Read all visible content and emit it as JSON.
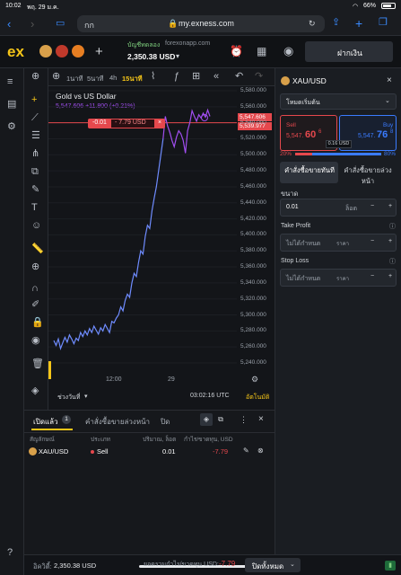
{
  "status_bar": {
    "time": "10:02",
    "date": "พฤ. 29 ม.ค.",
    "battery": "66%"
  },
  "browser": {
    "url_left": "กก",
    "url": "my.exness.com"
  },
  "app": {
    "logo": "ex",
    "account_type": "บัญชีทดลอง",
    "server": "forexonapp.com",
    "balance": "2,350.38 USD",
    "deposit_label": "ฝากเงิน"
  },
  "chart_toolbar": {
    "timeframes": [
      "1นาที",
      "5นาที",
      "4h",
      "15นาที"
    ],
    "active_timeframe": "15นาที"
  },
  "chart": {
    "title": "Gold vs US Dollar",
    "quote": "5,547.606 +11.800 (+0.21%)",
    "position_tag": {
      "pnl": "-0.01",
      "value": "- 7.79 USD",
      "close": "×"
    },
    "price_labels": {
      "sell": "5,547.606",
      "buy": "5,539.977"
    },
    "y_ticks": [
      "5,580.000",
      "5,560.000",
      "5,540.000",
      "5,520.000",
      "5,500.000",
      "5,480.000",
      "5,460.000",
      "5,440.000",
      "5,420.000",
      "5,400.000",
      "5,380.000",
      "5,360.000",
      "5,340.000",
      "5,320.000",
      "5,300.000",
      "5,280.000",
      "5,260.000",
      "5,240.000"
    ],
    "x_ticks": [
      "12:00",
      "29"
    ],
    "range_label": "ช่วงวันที่",
    "clock": "03:02:16 UTC",
    "auto_label": "อัตโนมัติ"
  },
  "chart_data": {
    "type": "line",
    "title": "Gold vs US Dollar",
    "ylim": [
      5240,
      5580
    ],
    "x_ticks": [
      "12:00",
      "29"
    ],
    "values": [
      5268,
      5262,
      5270,
      5258,
      5265,
      5272,
      5266,
      5275,
      5270,
      5264,
      5271,
      5268,
      5278,
      5273,
      5280,
      5275,
      5283,
      5278,
      5286,
      5281,
      5276,
      5284,
      5280,
      5288,
      5283,
      5278,
      5292,
      5290,
      5296,
      5300,
      5310,
      5305,
      5318,
      5326,
      5322,
      5340,
      5352,
      5348,
      5366,
      5380,
      5376,
      5398,
      5412,
      5408,
      5430,
      5446,
      5460,
      5480,
      5500,
      5520,
      5548,
      5536,
      5528,
      5518,
      5510,
      5522,
      5530,
      5526,
      5518,
      5502,
      5530,
      5540,
      5555,
      5548,
      5542,
      5550,
      5546,
      5552,
      5547,
      5556,
      5548
    ],
    "series": [
      {
        "name": "5,547.606 +11.800 (+0.21%)",
        "color_segments": [
          "#6f8cff",
          "#a14ef0"
        ]
      }
    ]
  },
  "right_panel": {
    "symbol": "XAU/USD",
    "mode": "โหมดเริ่มต้น",
    "sell": {
      "label": "Sell",
      "price_main": "5,547.",
      "price_big": "60",
      "price_sup": "6"
    },
    "buy": {
      "label": "Buy",
      "price_main": "5,547.",
      "price_big": "76",
      "price_sup": "8"
    },
    "spread": "0.16 USD",
    "sentiment": {
      "sell_pct": "20%",
      "buy_pct": "80%",
      "sell_fraction": 0.2
    },
    "tabs": [
      "คำสั่งซื้อขายทันที",
      "คำสั่งซื้อขายล่วงหน้า"
    ],
    "volume_label": "ขนาด",
    "volume_value": "0.01",
    "volume_unit": "ล็อต",
    "take_profit_label": "Take Profit",
    "take_profit_placeholder": "ไม่ได้กำหนด",
    "stop_loss_label": "Stop Loss",
    "stop_loss_placeholder": "ไม่ได้กำหนด",
    "price_unit": "ราคา"
  },
  "positions": {
    "tabs": [
      "เปิดแล้ว",
      "1",
      "คำสั่งซื้อขายล่วงหน้า",
      "ปิด"
    ],
    "headers": [
      "สัญลักษณ์",
      "ประเภท",
      "ปริมาณ, ล็อต",
      "กำไร/ขาดทุน, USD"
    ],
    "rows": [
      {
        "symbol": "XAU/USD",
        "type": "Sell",
        "volume": "0.01",
        "pnl": "-7.79"
      }
    ]
  },
  "footer": {
    "equity_label": "อิควิตี้:",
    "equity": "2,350.38 USD",
    "total_label": "ยอดรวมกำไร/ขาดทุน USD:",
    "total_pnl": "-7.79",
    "close_all": "ปิดทั้งหมด"
  },
  "colors": {
    "accent": "#f5c518",
    "sell": "#e5484d",
    "buy": "#3a7bff",
    "line_blue": "#6f8cff",
    "line_purple": "#a14ef0"
  }
}
